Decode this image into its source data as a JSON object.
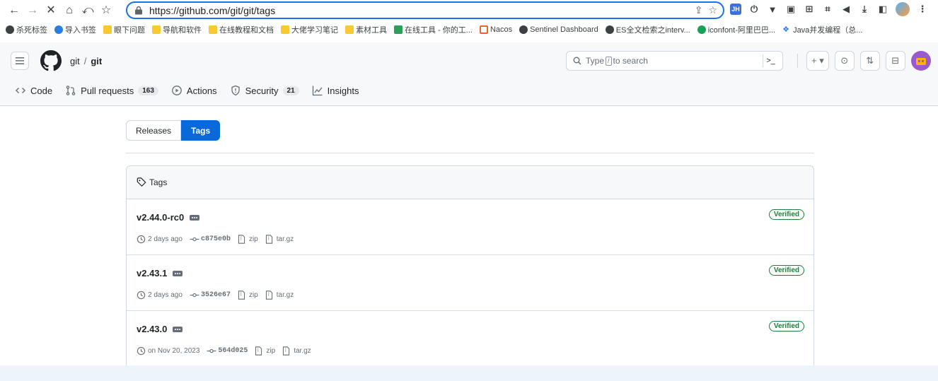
{
  "browser": {
    "url": "https://github.com/git/git/tags",
    "colors": {
      "focus_ring": "#1a73e8"
    },
    "extensions": [
      {
        "icon": "jh-icon",
        "text": "JH",
        "color": "#3b6fe0"
      }
    ]
  },
  "bookmarks": [
    {
      "icon": "globe-icon",
      "label": "杀死标签"
    },
    {
      "icon": "gear-icon",
      "label": "导入书签"
    },
    {
      "icon": "folder-icon",
      "label": "眼下问题"
    },
    {
      "icon": "folder-icon",
      "label": "导航和软件"
    },
    {
      "icon": "folder-icon",
      "label": "在线教程和文档"
    },
    {
      "icon": "folder-icon",
      "label": "大佬学习笔记"
    },
    {
      "icon": "folder-icon",
      "label": "素材工具"
    },
    {
      "icon": "tool-icon",
      "label": "在线工具 - 你的工..."
    },
    {
      "icon": "nacos-icon",
      "label": "Nacos"
    },
    {
      "icon": "globe-icon",
      "label": "Sentinel Dashboard"
    },
    {
      "icon": "globe-icon",
      "label": "ES全文检索之interv..."
    },
    {
      "icon": "iconfont-icon",
      "label": "iconfont-阿里巴巴..."
    },
    {
      "icon": "java-icon",
      "label": "Java并发编程（总..."
    }
  ],
  "github": {
    "owner": "git",
    "separator": "/",
    "repo": "git",
    "search": {
      "prefix": "Type",
      "key": "/",
      "suffix": "to search"
    },
    "command_palette": ">_",
    "new_button": "+ ▾",
    "colors": {
      "primary": "#0969da",
      "verified": "#1a7f37",
      "header_bg": "#f6f8fa"
    }
  },
  "repo_tabs": [
    {
      "icon": "code-icon",
      "label": "Code",
      "count": ""
    },
    {
      "icon": "pull-request-icon",
      "label": "Pull requests",
      "count": "163"
    },
    {
      "icon": "actions-icon",
      "label": "Actions",
      "count": ""
    },
    {
      "icon": "security-icon",
      "label": "Security",
      "count": "21"
    },
    {
      "icon": "insights-icon",
      "label": "Insights",
      "count": ""
    }
  ],
  "toggle": {
    "releases": "Releases",
    "tags": "Tags",
    "selected": "Tags"
  },
  "tags_box": {
    "title": "Tags",
    "tags": [
      {
        "name": "v2.44.0-rc0",
        "verified": "Verified",
        "date": "2 days ago",
        "sha": "c875e0b",
        "zip": "zip",
        "targz": "tar.gz"
      },
      {
        "name": "v2.43.1",
        "verified": "Verified",
        "date": "2 days ago",
        "sha": "3526e67",
        "zip": "zip",
        "targz": "tar.gz"
      },
      {
        "name": "v2.43.0",
        "verified": "Verified",
        "date": "on Nov 20, 2023",
        "sha": "564d025",
        "zip": "zip",
        "targz": "tar.gz"
      }
    ]
  }
}
